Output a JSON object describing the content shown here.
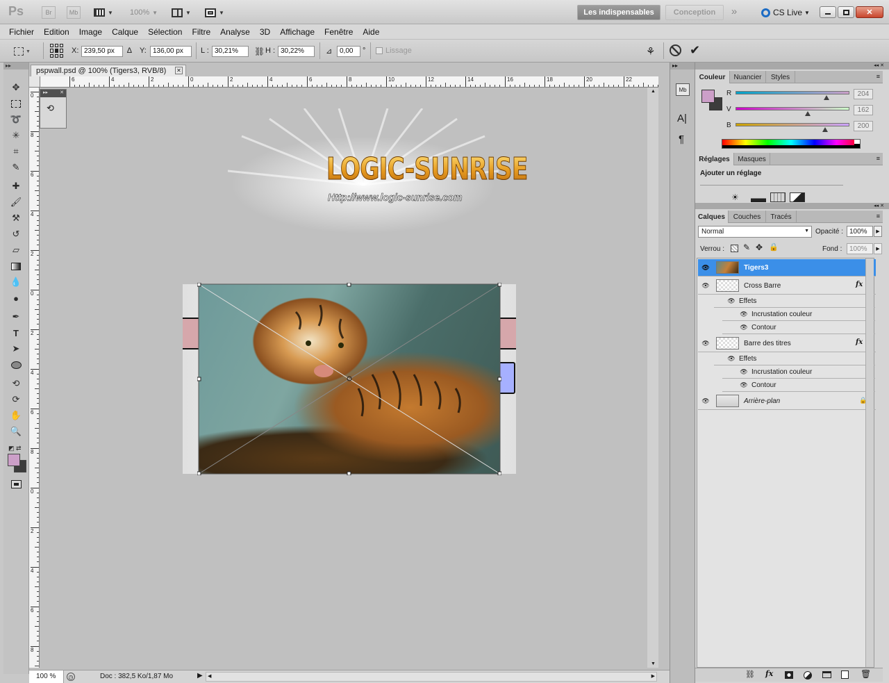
{
  "appbar": {
    "logo": "Ps",
    "br": "Br",
    "mb": "Mb",
    "zoom": "100%",
    "workspace_active": "Les indispensables",
    "workspace_other": "Conception",
    "more": "»",
    "cslive": "CS Live"
  },
  "menus": [
    "Fichier",
    "Edition",
    "Image",
    "Calque",
    "Sélection",
    "Filtre",
    "Analyse",
    "3D",
    "Affichage",
    "Fenêtre",
    "Aide"
  ],
  "options": {
    "x_label": "X:",
    "x_value": "239,50 px",
    "y_label": "Y:",
    "y_value": "136,00 px",
    "w_label": "L :",
    "w_value": "30,21%",
    "h_label": "H :",
    "h_value": "30,22%",
    "angle_value": "0,00",
    "degree": "°",
    "smooth_label": "Lissage"
  },
  "document": {
    "tab_title": "pspwall.psd @ 100% (Tigers3, RVB/8)",
    "ruler_h_labels": [
      "6",
      "4",
      "2",
      "0",
      "2",
      "4",
      "6",
      "8",
      "10",
      "12",
      "14",
      "16",
      "18",
      "20",
      "22"
    ],
    "ruler_v_labels": [
      "0",
      "8",
      "6",
      "4",
      "2",
      "0",
      "2",
      "4",
      "6",
      "8",
      "0",
      "2",
      "4",
      "6",
      "8"
    ],
    "logo_title": "LOGIC-SUNRISE",
    "logo_url": "Http://www.logic-sunrise.com"
  },
  "status": {
    "zoom": "100 %",
    "doc": "Doc : 382,5 Ko/1,87 Mo"
  },
  "color_panel": {
    "tabs": [
      "Couleur",
      "Nuancier",
      "Styles"
    ],
    "fg_color": "#cc9fc8",
    "bg_color": "#3c3c3c",
    "channels": [
      {
        "label": "R",
        "value": "204",
        "pos": 0.8
      },
      {
        "label": "V",
        "value": "162",
        "pos": 0.635
      },
      {
        "label": "B",
        "value": "200",
        "pos": 0.784
      }
    ]
  },
  "adjust_panel": {
    "tabs": [
      "Réglages",
      "Masques"
    ],
    "title": "Ajouter un réglage"
  },
  "layers_panel": {
    "tabs": [
      "Calques",
      "Couches",
      "Tracés"
    ],
    "blend_mode": "Normal",
    "opacity_label": "Opacité :",
    "opacity_value": "100%",
    "lock_label": "Verrou :",
    "fill_label": "Fond :",
    "fill_value": "100%",
    "layers": [
      {
        "name": "Tigers3",
        "selected": true
      },
      {
        "name": "Cross Barre",
        "fx": "fx"
      },
      {
        "name": "Effets",
        "sub": 1
      },
      {
        "name": "Incrustation couleur",
        "sub": 2
      },
      {
        "name": "Contour",
        "sub": 2
      },
      {
        "name": "Barre des titres",
        "fx": "fx"
      },
      {
        "name": "Effets",
        "sub": 1
      },
      {
        "name": "Incrustation couleur",
        "sub": 2
      },
      {
        "name": "Contour",
        "sub": 2
      },
      {
        "name": "Arrière-plan",
        "italic": true
      }
    ]
  }
}
